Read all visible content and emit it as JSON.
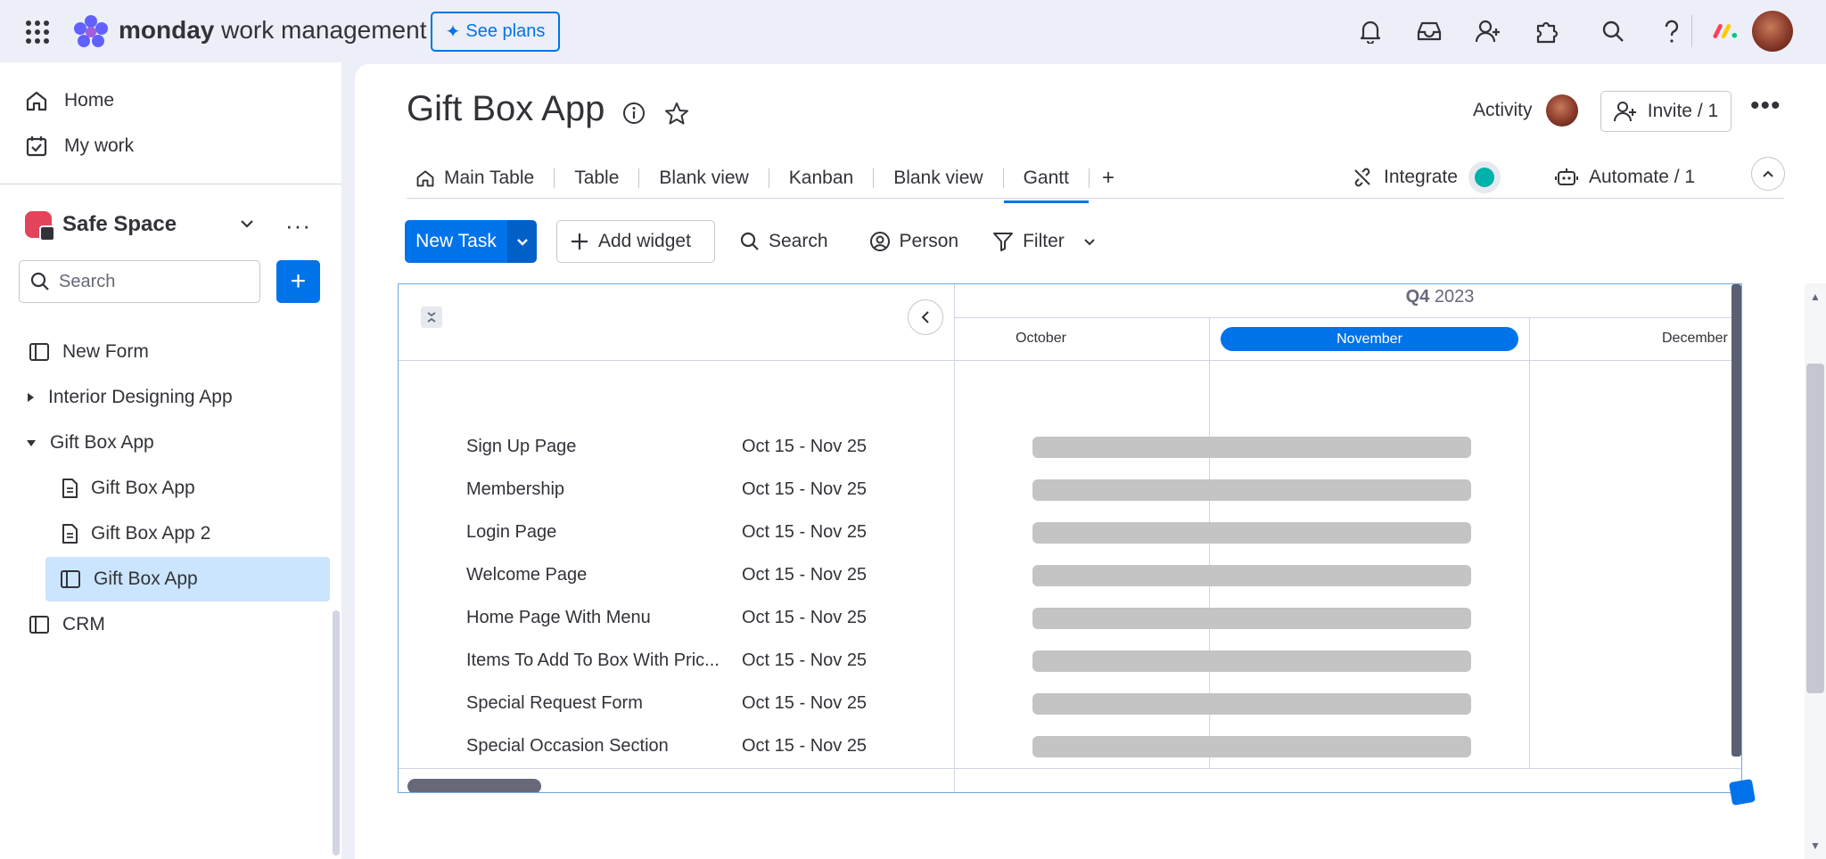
{
  "topbar": {
    "brand_bold": "monday",
    "brand_rest": " work management",
    "see_plans_label": "See plans",
    "icons": [
      "apps-grid-icon",
      "bell-icon",
      "inbox-icon",
      "invite-user-icon",
      "puzzle-icon",
      "search-icon",
      "help-icon",
      "monday-apps-icon",
      "user-avatar"
    ]
  },
  "sidebar": {
    "nav": [
      {
        "label": "Home",
        "icon": "home-icon"
      },
      {
        "label": "My work",
        "icon": "calendar-check-icon"
      }
    ],
    "workspace": {
      "name": "Safe Space",
      "more": "···"
    },
    "search_placeholder": "Search",
    "add_label": "+",
    "tree": [
      {
        "label": "New Form",
        "icon": "board-icon"
      },
      {
        "label": "Interior Designing App",
        "icon": "caret-right-icon"
      },
      {
        "label": "Gift Box App",
        "icon": "caret-down-icon"
      },
      {
        "label": "Gift Box App",
        "icon": "doc-icon"
      },
      {
        "label": "Gift Box App 2",
        "icon": "doc-icon"
      },
      {
        "label": "Gift Box App",
        "icon": "board-icon"
      },
      {
        "label": "CRM",
        "icon": "board-icon"
      }
    ]
  },
  "board": {
    "title": "Gift Box App",
    "activity_label": "Activity",
    "invite_label": "Invite / 1",
    "tabs": [
      "Main Table",
      "Table",
      "Blank view",
      "Kanban",
      "Blank view",
      "Gantt"
    ],
    "active_tab": "Gantt",
    "add_tab": "+",
    "integrate_label": "Integrate",
    "automate_label": "Automate / 1"
  },
  "toolbar": {
    "new_task_label": "New Task",
    "add_widget_label": "Add widget",
    "search_label": "Search",
    "person_label": "Person",
    "filter_label": "Filter"
  },
  "gantt": {
    "quarter_bold": "Q4",
    "quarter_year": " 2023",
    "months": [
      "October",
      "November",
      "December"
    ],
    "current_month": "November",
    "tasks": [
      {
        "name": "Sign Up Page",
        "dates": "Oct 15 - Nov 25"
      },
      {
        "name": "Membership",
        "dates": "Oct 15 - Nov 25"
      },
      {
        "name": "Login Page",
        "dates": "Oct 15 - Nov 25"
      },
      {
        "name": "Welcome Page",
        "dates": "Oct 15 - Nov 25"
      },
      {
        "name": "Home Page With Menu",
        "dates": "Oct 15 - Nov 25"
      },
      {
        "name": "Items To Add To Box With Pric...",
        "dates": "Oct 15 - Nov 25"
      },
      {
        "name": "Special Request Form",
        "dates": "Oct 15 - Nov 25"
      },
      {
        "name": "Special Occasion Section",
        "dates": "Oct 15 - Nov 25"
      }
    ],
    "bar_color": "#c4c4c4"
  },
  "colors": {
    "accent": "#0073ea",
    "active_row": "#cce5ff",
    "workspace_badge": "#e2445c"
  }
}
